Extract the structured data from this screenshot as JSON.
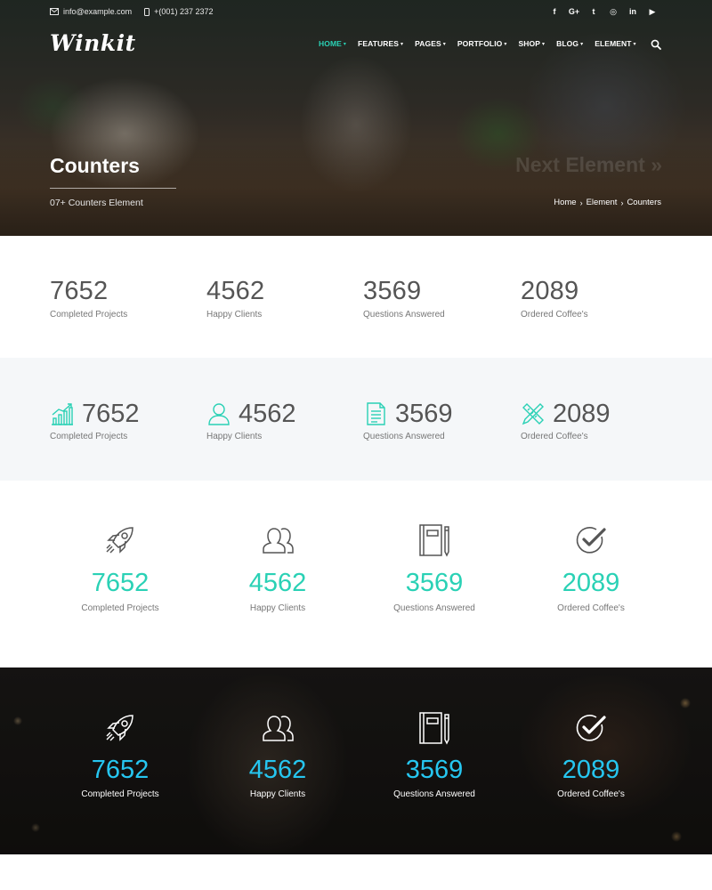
{
  "topbar": {
    "email": "info@example.com",
    "phone": "+(001) 237 2372",
    "social": [
      {
        "label": "f",
        "icon": "facebook-icon"
      },
      {
        "label": "G+",
        "icon": "google-plus-icon"
      },
      {
        "label": "t",
        "icon": "twitter-icon"
      },
      {
        "label": "◎",
        "icon": "instagram-icon"
      },
      {
        "label": "in",
        "icon": "linkedin-icon"
      },
      {
        "label": "▶",
        "icon": "youtube-icon"
      }
    ]
  },
  "brand": {
    "logo_text": "Winkit"
  },
  "nav": {
    "items": [
      "HOME",
      "FEATURES",
      "PAGES",
      "PORTFOLIO",
      "SHOP",
      "BLOG",
      "ELEMENT"
    ],
    "active": "HOME",
    "search_icon": "search-icon"
  },
  "hero": {
    "title": "Counters",
    "subtitle": "07+ Counters Element",
    "next_link": "Next Element »",
    "breadcrumb": [
      "Home",
      "Element",
      "Counters"
    ]
  },
  "accent": "#2ad1b5",
  "accent_dark_section": "#26c6f0",
  "counters": [
    {
      "value": "7652",
      "label": "Completed Projects",
      "icon_small": "growth-chart-icon",
      "icon_large": "rocket-icon"
    },
    {
      "value": "4562",
      "label": "Happy Clients",
      "icon_small": "user-icon",
      "icon_large": "users-icon"
    },
    {
      "value": "3569",
      "label": "Questions Answered",
      "icon_small": "document-icon",
      "icon_large": "notebook-pencil-icon"
    },
    {
      "value": "2089",
      "label": "Ordered Coffee's",
      "icon_small": "pencil-ruler-icon",
      "icon_large": "check-circle-icon"
    }
  ]
}
